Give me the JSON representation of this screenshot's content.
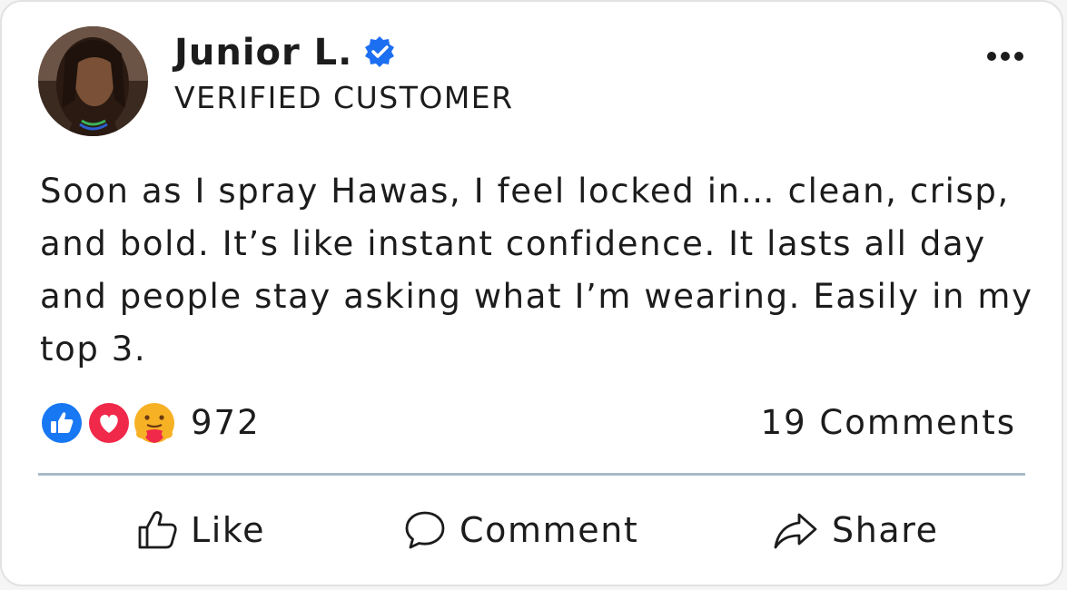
{
  "post": {
    "author": {
      "name": "Junior L.",
      "subtitle": "VERIFIED CUSTOMER"
    },
    "text": "Soon as I spray Hawas, I feel locked in… clean, crisp, and bold. It’s like instant confidence. It lasts all day and people stay asking what I’m wearing. Easily in my top 3.",
    "reactions": {
      "icons": [
        "like-icon",
        "love-icon",
        "care-icon"
      ],
      "count": "972"
    },
    "comments_label": "19 Comments",
    "actions": {
      "like": "Like",
      "comment": "Comment",
      "share": "Share"
    }
  },
  "icons": {
    "verified": "verified-badge-icon",
    "more": "more-options-icon"
  },
  "colors": {
    "like_blue": "#1877f2",
    "love_red": "#f0284a",
    "care_yellow": "#f7b125",
    "verified_blue": "#1d6ff2",
    "divider": "#a8bac6",
    "text": "#1c1c1c"
  }
}
